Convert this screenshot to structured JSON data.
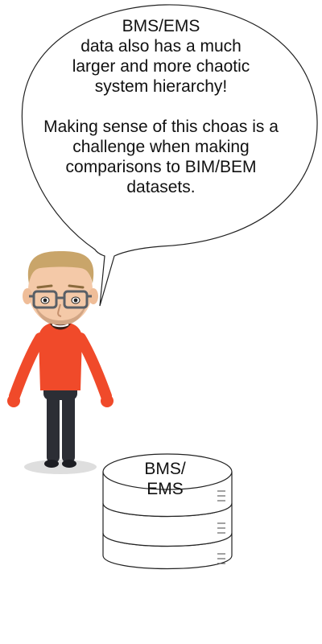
{
  "speech_bubble": {
    "lines_1": [
      "BMS/EMS",
      "data also has a much",
      "larger and more chaotic",
      "system hierarchy!"
    ],
    "lines_2": [
      "Making sense of this choas is a",
      "challenge when making",
      "comparisons to BIM/BEM",
      "datasets."
    ]
  },
  "database": {
    "label_lines": [
      "BMS/",
      "EMS"
    ]
  },
  "colors": {
    "shirt": "#f04a2a",
    "pants": "#2c2e35",
    "skin": "#f4c9a8",
    "hair": "#c9a56a",
    "glasses": "#5a5f66",
    "outline": "#222222",
    "shadow": "#dedede"
  }
}
